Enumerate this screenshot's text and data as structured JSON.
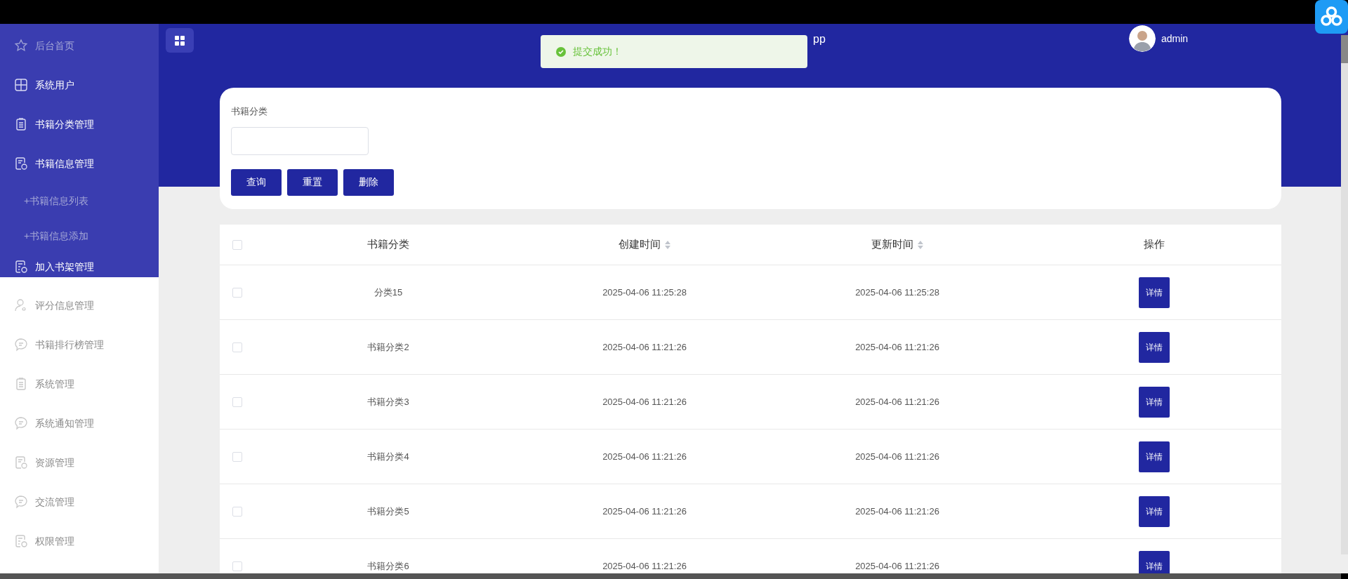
{
  "sidebar": {
    "upper_items": [
      {
        "label": "后台首页",
        "kind": "item",
        "dim": true
      },
      {
        "label": "系统用户",
        "kind": "item",
        "dim": false
      },
      {
        "label": "书籍分类管理",
        "kind": "item",
        "dim": false
      },
      {
        "label": "书籍信息管理",
        "kind": "item",
        "dim": false
      },
      {
        "label": "+书籍信息列表",
        "kind": "subitem",
        "dim": true
      },
      {
        "label": "+书籍信息添加",
        "kind": "subitem",
        "dim": true
      },
      {
        "label": "加入书架管理",
        "kind": "item",
        "dim": false
      }
    ],
    "lower_items": [
      {
        "label": "评分信息管理"
      },
      {
        "label": "书籍排行榜管理"
      },
      {
        "label": "系统管理"
      },
      {
        "label": "系统通知管理"
      },
      {
        "label": "资源管理"
      },
      {
        "label": "交流管理"
      },
      {
        "label": "权限管理"
      }
    ]
  },
  "header": {
    "title_fragment": "pp",
    "user": "admin"
  },
  "toast": {
    "message": "提交成功！"
  },
  "search": {
    "label": "书籍分类",
    "buttons": [
      "查询",
      "重置",
      "删除"
    ]
  },
  "table": {
    "select_all_checked": false,
    "columns": [
      {
        "label": "书籍分类",
        "sortable": false
      },
      {
        "label": "创建时间",
        "sortable": true
      },
      {
        "label": "更新时间",
        "sortable": true
      },
      {
        "label": "操作",
        "sortable": false
      }
    ],
    "rows": [
      {
        "checked": false,
        "category": "分类15",
        "created": "2025-04-06 11:25:28",
        "updated": "2025-04-06 11:25:28",
        "action": "详情"
      },
      {
        "checked": false,
        "category": "书籍分类2",
        "created": "2025-04-06 11:21:26",
        "updated": "2025-04-06 11:21:26",
        "action": "详情"
      },
      {
        "checked": false,
        "category": "书籍分类3",
        "created": "2025-04-06 11:21:26",
        "updated": "2025-04-06 11:21:26",
        "action": "详情"
      },
      {
        "checked": false,
        "category": "书籍分类4",
        "created": "2025-04-06 11:21:26",
        "updated": "2025-04-06 11:21:26",
        "action": "详情"
      },
      {
        "checked": false,
        "category": "书籍分类5",
        "created": "2025-04-06 11:21:26",
        "updated": "2025-04-06 11:21:26",
        "action": "详情"
      },
      {
        "checked": false,
        "category": "书籍分类6",
        "created": "2025-04-06 11:21:26",
        "updated": "2025-04-06 11:21:26",
        "action": "详情"
      }
    ]
  }
}
